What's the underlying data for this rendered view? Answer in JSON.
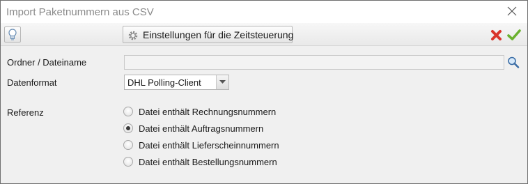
{
  "window": {
    "title": "Import Paketnummern aus CSV"
  },
  "toolbar": {
    "schedule_label": "Einstellungen für die Zeitsteuerung",
    "hint_icon": "lightbulb-icon",
    "cancel_icon": "red-x-icon",
    "ok_icon": "green-check-icon"
  },
  "form": {
    "path": {
      "label": "Ordner / Dateiname",
      "value": "",
      "placeholder": ""
    },
    "format": {
      "label": "Datenformat",
      "selected": "DHL Polling-Client"
    },
    "reference": {
      "label": "Referenz",
      "options": [
        {
          "label": "Datei enthält Rechnungsnummern",
          "checked": false
        },
        {
          "label": "Datei enthält Auftragsnummern",
          "checked": true
        },
        {
          "label": "Datei enthält Lieferscheinnummern",
          "checked": false
        },
        {
          "label": "Datei enthält Bestellungsnummern",
          "checked": false
        }
      ]
    }
  },
  "colors": {
    "cancel": "#d9352b",
    "ok": "#6bb12f",
    "window_bg": "#f0f0f0"
  }
}
